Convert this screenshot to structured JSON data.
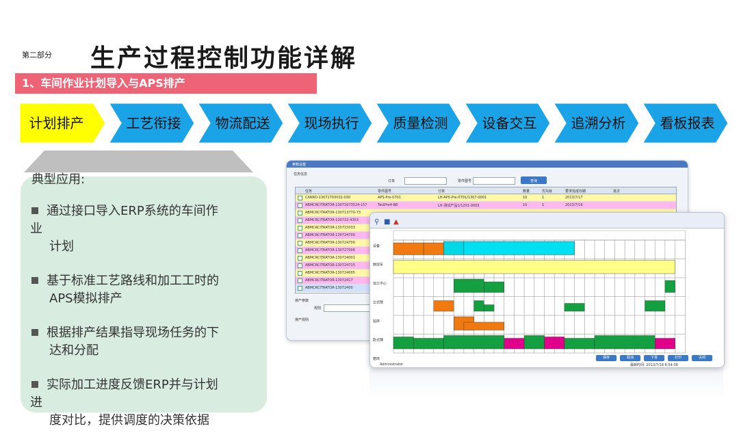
{
  "header": {
    "part_label": "第二部分",
    "title": "生产过程控制功能详解"
  },
  "section": {
    "subtitle": "1、车间作业计划导入与APS排产"
  },
  "process_steps": [
    {
      "label": "计划排产",
      "active": true
    },
    {
      "label": "工艺衔接",
      "active": false
    },
    {
      "label": "物流配送",
      "active": false
    },
    {
      "label": "现场执行",
      "active": false
    },
    {
      "label": "质量检测",
      "active": false
    },
    {
      "label": "设备交互",
      "active": false
    },
    {
      "label": "追溯分析",
      "active": false
    },
    {
      "label": "看板报表",
      "active": false
    }
  ],
  "colors": {
    "active_step": "#ffff00",
    "step": "#1aa3e6",
    "subtitle_bar": "#ef6376",
    "panel": "#d8ece0"
  },
  "panel": {
    "heading": "典型应用:",
    "bullets": [
      {
        "line1": "通过接口导入ERP系统的车间作",
        "line2": "业",
        "line3": "计划"
      },
      {
        "line1": "基于标准工艺路线和加工工时的",
        "line2": "",
        "line3": "APS模拟排产"
      },
      {
        "line1": "根据排产结果指导现场任务的下",
        "line2": "",
        "line3": "达和分配"
      },
      {
        "line1": "实际加工进度反馈ERP并与计划",
        "line2": "进",
        "line3": "度对比，提供调度的决策依据"
      }
    ]
  },
  "screenshot_back": {
    "window_title": "参数设置",
    "group_title": "任务信息",
    "order_label": "订单",
    "drawing_label": "零件图号",
    "query_button": "查询",
    "columns": [
      "任务",
      "零件图号",
      "订单",
      "数量",
      "优先级",
      "要求完成日期",
      "批次"
    ],
    "rows": [
      {
        "task": "CANRD-13071703032-030",
        "part": "APS-Pre-0701",
        "order": "LH-APS-Pre-0701/1307-0001",
        "qty": "10",
        "pri": "1",
        "date": "2013/7/17"
      },
      {
        "task": "ABMCRCITRATOR-13071673524-157",
        "part": "TestPre4-B8",
        "order": "LH-测试产品1/1201-0003",
        "qty": "10",
        "pri": "1",
        "date": "2013/7/16"
      },
      {
        "task": "ABMCRCITRATOR-130713770-73",
        "part": "",
        "order": "",
        "qty": "",
        "pri": "",
        "date": ""
      },
      {
        "task": "ABMCRCITRATOR-130722-4353",
        "part": "",
        "order": "",
        "qty": "",
        "pri": "",
        "date": ""
      },
      {
        "task": "ABMCRCITRATOR-130715033",
        "part": "",
        "order": "",
        "qty": "",
        "pri": "",
        "date": ""
      },
      {
        "task": "ABMCRCITRATOR-130724700",
        "part": "",
        "order": "",
        "qty": "",
        "pri": "",
        "date": ""
      },
      {
        "task": "ABMCRCITRATOR-130724700",
        "part": "",
        "order": "",
        "qty": "",
        "pri": "",
        "date": ""
      },
      {
        "task": "ABMCRCITRATOR-130727006",
        "part": "",
        "order": "",
        "qty": "",
        "pri": "",
        "date": ""
      },
      {
        "task": "ABMCRCITRATOR-130724001",
        "part": "",
        "order": "",
        "qty": "",
        "pri": "",
        "date": ""
      },
      {
        "task": "ABMCRCITRATOR-130724715",
        "part": "",
        "order": "",
        "qty": "",
        "pri": "",
        "date": ""
      },
      {
        "task": "ABMCRCITRATOR-130724005",
        "part": "",
        "order": "",
        "qty": "",
        "pri": "",
        "date": ""
      },
      {
        "task": "ABMCRCITRATOR-13072417",
        "part": "",
        "order": "",
        "qty": "",
        "pri": "",
        "date": ""
      },
      {
        "task": "ABMCRCITRATOR-13072400",
        "part": "",
        "order": "",
        "qty": "",
        "pri": "",
        "date": ""
      }
    ],
    "param_label": "排产参数",
    "rule_label": "规则",
    "result_label": "排产规则"
  },
  "screenshot_front": {
    "resources": [
      "设备",
      "数控车",
      "加工中心",
      "立式铣",
      "钻床",
      "卧式镗",
      "磨床"
    ],
    "buttons": [
      "保存",
      "取消",
      "下发",
      "打印",
      "关闭"
    ],
    "status_left": "Administrator",
    "status_right": "最新时间: 2013/7/18 8:54:36"
  }
}
